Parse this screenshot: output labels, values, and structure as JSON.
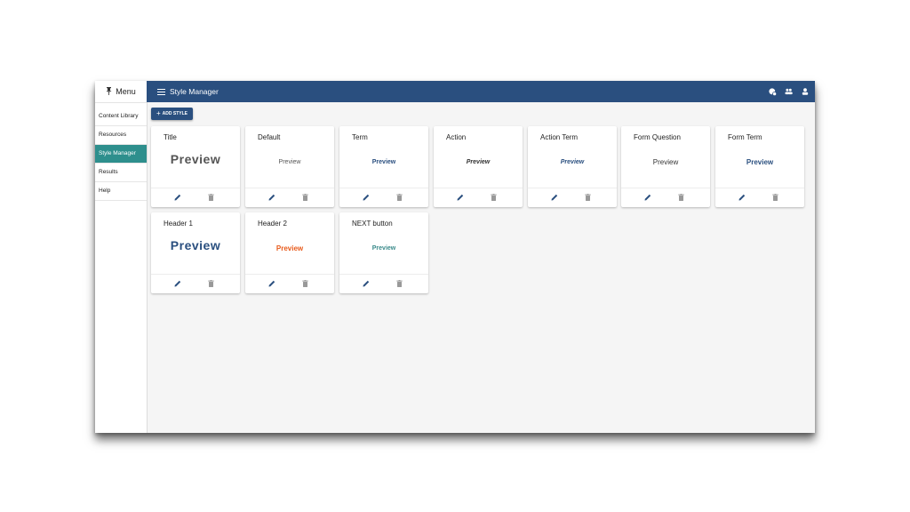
{
  "sidebar": {
    "menu_label": "Menu",
    "items": [
      {
        "label": "Content Library"
      },
      {
        "label": "Resources"
      },
      {
        "label": "Style Manager"
      },
      {
        "label": "Results"
      },
      {
        "label": "Help"
      }
    ]
  },
  "header": {
    "title": "Style Manager",
    "icons": [
      "help-chat-icon",
      "users-icon",
      "account-icon"
    ]
  },
  "toolbar": {
    "add_style_label": "ADD STYLE",
    "add_icon": "+"
  },
  "cards": [
    {
      "title": "Title",
      "preview": "Preview"
    },
    {
      "title": "Default",
      "preview": "Preview"
    },
    {
      "title": "Term",
      "preview": "Preview"
    },
    {
      "title": "Action",
      "preview": "Preview"
    },
    {
      "title": "Action Term",
      "preview": "Preview"
    },
    {
      "title": "Form Question",
      "preview": "Preview"
    },
    {
      "title": "Form Term",
      "preview": "Preview"
    },
    {
      "title": "Header 1",
      "preview": "Preview"
    },
    {
      "title": "Header 2",
      "preview": "Preview"
    },
    {
      "title": "NEXT button",
      "preview": "Preview"
    }
  ],
  "colors": {
    "header_bg": "#2a4f7f",
    "active_nav": "#2e8f8d",
    "header2_preview": "#e85a1a",
    "next_preview": "#3a8a8a"
  }
}
